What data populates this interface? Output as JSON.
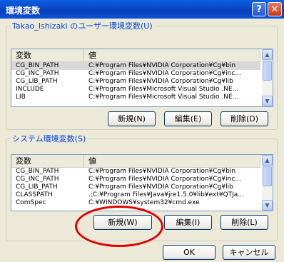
{
  "window": {
    "title": "環境変数",
    "help_label": "?",
    "close_label": "✕"
  },
  "user_group": {
    "legend": "Takao_Ishizaki のユーザー環境変数(U)",
    "columns": [
      "変数",
      "値"
    ],
    "rows": [
      {
        "name": "CG_BIN_PATH",
        "value": "C:¥Program Files¥NVIDIA Corporation¥Cg¥bin"
      },
      {
        "name": "CG_INC_PATH",
        "value": "C:¥Program Files¥NVIDIA Corporation¥Cg¥inc..."
      },
      {
        "name": "CG_LIB_PATH",
        "value": "C:¥Program Files¥NVIDIA Corporation¥Cg¥lib"
      },
      {
        "name": "INCLUDE",
        "value": "C:¥Program Files¥Microsoft Visual Studio .NE..."
      },
      {
        "name": "LIB",
        "value": "C:¥Program Files¥Microsoft Visual Studio .NE..."
      }
    ],
    "buttons": {
      "new": "新規(N)",
      "edit": "編集(E)",
      "delete": "削除(D)"
    }
  },
  "system_group": {
    "legend": "システム環境変数(S)",
    "columns": [
      "変数",
      "値"
    ],
    "rows": [
      {
        "name": "CG_BIN_PATH",
        "value": "C:¥Program Files¥NVIDIA Corporation¥Cg¥bin"
      },
      {
        "name": "CG_INC_PATH",
        "value": "C:¥Program Files¥NVIDIA Corporation¥Cg¥inc..."
      },
      {
        "name": "CG_LIB_PATH",
        "value": "C:¥Program Files¥NVIDIA Corporation¥Cg¥lib"
      },
      {
        "name": "CLASSPATH",
        "value": ".;C:¥Program Files¥Java¥jre1.5.0¥lib¥ext¥QTJa..."
      },
      {
        "name": "ComSpec",
        "value": "C:¥WINDOWS¥system32¥cmd.exe"
      }
    ],
    "buttons": {
      "new": "新規(W)",
      "edit": "編集(I)",
      "delete": "削除(L)"
    }
  },
  "footer": {
    "ok": "OK",
    "cancel": "キャンセル"
  },
  "colors": {
    "annotation": "#e00000",
    "title_bar": "#0b49c7",
    "legend_text": "#0046d5"
  }
}
